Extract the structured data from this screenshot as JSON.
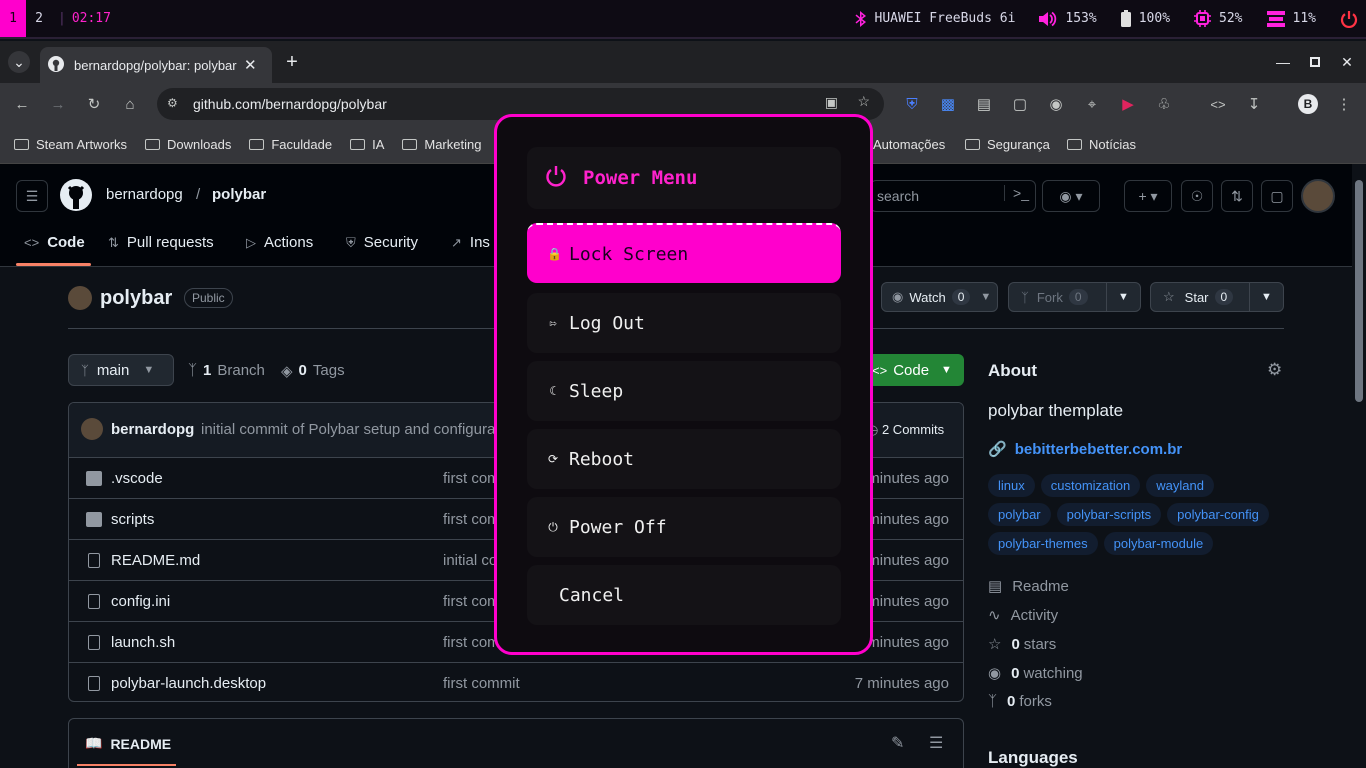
{
  "polybar": {
    "workspaces": [
      "1",
      "2"
    ],
    "clock": "02:17",
    "bluetooth_device": "HUAWEI FreeBuds 6i",
    "volume": "153%",
    "battery": "100%",
    "cpu": "52%",
    "memory": "11%"
  },
  "browser": {
    "tab_title": "bernardopg/polybar: polybar",
    "url": "github.com/bernardopg/polybar",
    "profile_initial": "B",
    "bookmarks": [
      "Steam Artworks",
      "Downloads",
      "Faculdade",
      "IA",
      "Marketing",
      "Automações",
      "Segurança",
      "Notícias"
    ]
  },
  "github": {
    "owner": "bernardopg",
    "repo": "polybar",
    "search_placeholder": "search",
    "nav_tabs": [
      "Code",
      "Pull requests",
      "Actions",
      "Security",
      "Ins"
    ],
    "visibility": "Public",
    "watch_label": "Watch",
    "watch_count": "0",
    "fork_label": "Fork",
    "fork_count": "0",
    "star_label": "Star",
    "star_count": "0",
    "branch": "main",
    "branch_count": "1",
    "branch_label": "Branch",
    "tag_count": "0",
    "tag_label": "Tags",
    "code_button": "Code",
    "last_commit_author": "bernardopg",
    "last_commit_message": "initial commit of Polybar setup and configura",
    "commits_label": "2 Commits",
    "files": [
      {
        "name": ".vscode",
        "type": "folder",
        "message": "first com",
        "age": "minutes ago"
      },
      {
        "name": "scripts",
        "type": "folder",
        "message": "first com",
        "age": "minutes ago"
      },
      {
        "name": "README.md",
        "type": "file",
        "message": "initial co",
        "age": "minutes ago"
      },
      {
        "name": "config.ini",
        "type": "file",
        "message": "first com",
        "age": "minutes ago"
      },
      {
        "name": "launch.sh",
        "type": "file",
        "message": "first com",
        "age": "minutes ago"
      },
      {
        "name": "polybar-launch.desktop",
        "type": "file",
        "message": "first commit",
        "age": "7 minutes ago"
      }
    ],
    "readme_tab": "README",
    "about": {
      "heading": "About",
      "description": "polybar themplate",
      "website": "bebitterbebetter.com.br",
      "topics": [
        "linux",
        "customization",
        "wayland",
        "polybar",
        "polybar-scripts",
        "polybar-config",
        "polybar-themes",
        "polybar-module"
      ],
      "readme": "Readme",
      "activity": "Activity",
      "stars_count": "0",
      "stars_label": "stars",
      "watching_count": "0",
      "watching_label": "watching",
      "forks_count": "0",
      "forks_label": "forks",
      "languages": "Languages"
    }
  },
  "power_menu": {
    "title": "Power Menu",
    "items": [
      {
        "label": "Lock Screen",
        "icon": "lock-icon",
        "selected": true
      },
      {
        "label": "Log Out",
        "icon": "logout-icon",
        "selected": false
      },
      {
        "label": "Sleep",
        "icon": "moon-icon",
        "selected": false
      },
      {
        "label": "Reboot",
        "icon": "reboot-icon",
        "selected": false
      },
      {
        "label": "Power Off",
        "icon": "power-icon",
        "selected": false
      },
      {
        "label": "Cancel",
        "icon": "",
        "selected": false
      }
    ],
    "accent": "#ff00cc"
  }
}
